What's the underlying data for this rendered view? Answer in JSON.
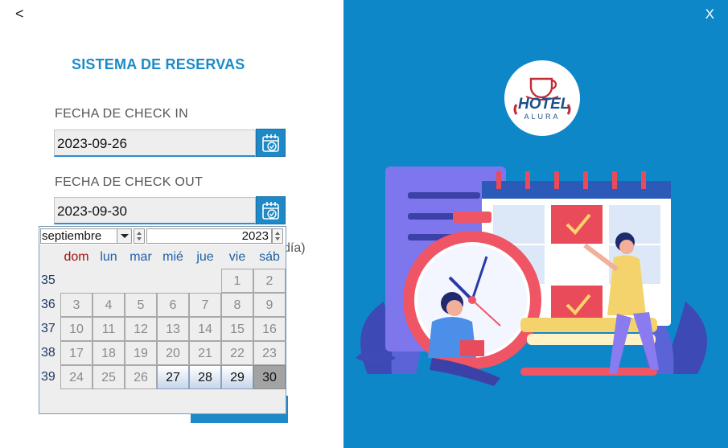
{
  "window": {
    "back_label": "<",
    "close_label": "X"
  },
  "form": {
    "title": "SISTEMA DE RESERVAS",
    "checkin_label": "FECHA DE CHECK IN",
    "checkin_value": "2023-09-26",
    "checkout_label": "FECHA DE CHECK OUT",
    "checkout_value": "2023-09-30",
    "partial_text": "día)"
  },
  "calendar": {
    "month": "septiembre",
    "year": "2023",
    "weekdays": [
      "dom",
      "lun",
      "mar",
      "mié",
      "jue",
      "vie",
      "sáb"
    ],
    "weeks": [
      {
        "num": "35",
        "days": [
          "",
          "",
          "",
          "",
          "",
          "1",
          "2"
        ]
      },
      {
        "num": "36",
        "days": [
          "3",
          "4",
          "5",
          "6",
          "7",
          "8",
          "9"
        ]
      },
      {
        "num": "37",
        "days": [
          "10",
          "11",
          "12",
          "13",
          "14",
          "15",
          "16"
        ]
      },
      {
        "num": "38",
        "days": [
          "17",
          "18",
          "19",
          "20",
          "21",
          "22",
          "23"
        ]
      },
      {
        "num": "39",
        "days": [
          "24",
          "25",
          "26",
          "27",
          "28",
          "29",
          "30"
        ]
      }
    ],
    "enabled_days": [
      "27",
      "28",
      "29"
    ],
    "selected_day": "30"
  },
  "logo": {
    "line1": "HOTEL",
    "line2": "ALURA"
  },
  "colors": {
    "accent": "#1d8ac7",
    "panel": "#0e87c9"
  }
}
